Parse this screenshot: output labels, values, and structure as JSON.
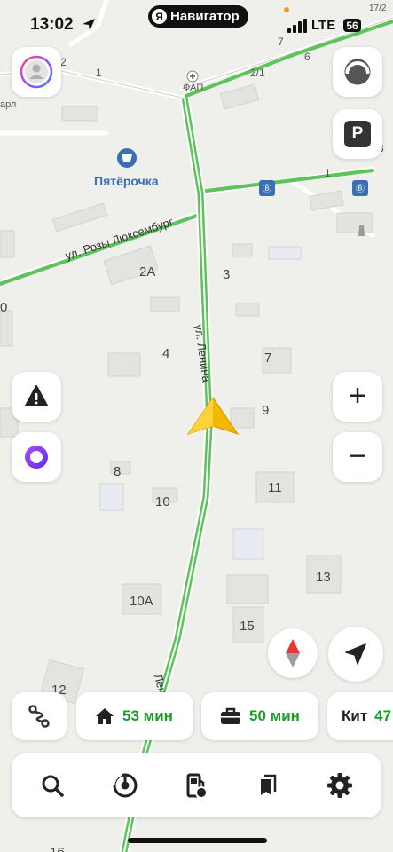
{
  "status_bar": {
    "time": "13:02",
    "app_pill": "Навигатор",
    "app_pill_badge": "Я",
    "network": "LTE",
    "battery": "56"
  },
  "map": {
    "street_lenina": "ул. Ленина",
    "street_lenina_bottom": "Ленина",
    "street_rozy": "ул. Розы Люксембург",
    "poi_shop": "Пятёрочка",
    "poi_fap": "ФАП",
    "house_numbers": {
      "h2a": "2А",
      "h3": "3",
      "h4": "4",
      "h7": "7",
      "h9": "9",
      "h8": "8",
      "h10": "10",
      "h11": "11",
      "h13": "13",
      "h10a": "10А",
      "h15": "15",
      "h12": "12",
      "h16": "16",
      "h1": "1",
      "h2_1": "2/1",
      "h2": "2",
      "h1b": "1",
      "h7b": "7",
      "h6": "6",
      "h3b": "3",
      "h17_2": "17/2",
      "h0": "0",
      "h_arl": "арл"
    },
    "route_color": "#5cc45a"
  },
  "buttons": {
    "profile": "avatar-icon",
    "speed_cam": "speed-icon",
    "parking": "P",
    "report": "warning-icon",
    "alice": "alice-icon",
    "zoom_in": "+",
    "zoom_out": "−",
    "compass": "compass-icon",
    "locate": "locate-icon"
  },
  "destinations": {
    "home_time": "53 мин",
    "work_time": "50 мин",
    "third_name": "Кит",
    "third_time": "47"
  },
  "tabs": [
    "search",
    "music",
    "fuel",
    "bookmarks",
    "settings"
  ],
  "colors": {
    "accent_green": "#1c9c2c",
    "arrow": "#f5b800",
    "alice": "#7a3cf0"
  }
}
